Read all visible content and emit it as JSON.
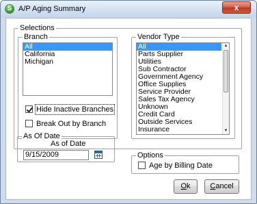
{
  "window": {
    "title": "A/P Aging Summary",
    "app_icon_glyph": "S",
    "close_glyph": "x"
  },
  "selections": {
    "legend": "Selections",
    "branch": {
      "legend": "Branch",
      "items": [
        {
          "label": "All",
          "selected": true
        },
        {
          "label": "California",
          "selected": false
        },
        {
          "label": "Michigan",
          "selected": false
        }
      ]
    },
    "vendor_type": {
      "legend": "Vendor Type",
      "items": [
        {
          "label": "All",
          "selected": true
        },
        {
          "label": "Parts Supplier",
          "selected": false
        },
        {
          "label": "Utilities",
          "selected": false
        },
        {
          "label": "Sub Contractor",
          "selected": false
        },
        {
          "label": "Government Agency",
          "selected": false
        },
        {
          "label": "Office Supplies",
          "selected": false
        },
        {
          "label": "Service Provider",
          "selected": false
        },
        {
          "label": "Sales Tax Agency",
          "selected": false
        },
        {
          "label": "Unknown",
          "selected": false
        },
        {
          "label": "Credit Card",
          "selected": false
        },
        {
          "label": "Outside Services",
          "selected": false
        },
        {
          "label": "Insurance",
          "selected": false
        }
      ]
    },
    "hide_inactive_branches": {
      "label": "Hide Inactive Branches",
      "checked": true
    },
    "break_out_by_branch": {
      "label": "Break Out by Branch",
      "checked": false
    }
  },
  "as_of_date": {
    "legend": "As Of Date",
    "label": "As of Date",
    "value": "9/15/2009"
  },
  "options": {
    "legend": "Options",
    "age_by_billing_date": {
      "label": "Age by Billing Date",
      "checked": false
    }
  },
  "buttons": {
    "ok_mnemonic": "O",
    "ok_rest": "k",
    "cancel_mnemonic": "C",
    "cancel_rest": "ancel"
  }
}
